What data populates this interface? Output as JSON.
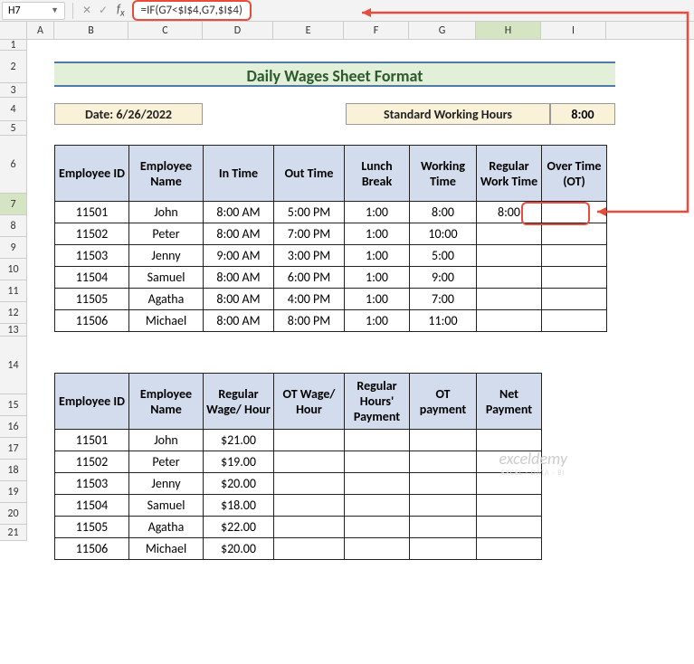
{
  "nameBox": "H7",
  "formula": "=IF(G7<$I$4,G7,$I$4)",
  "columns": [
    "A",
    "B",
    "C",
    "D",
    "E",
    "F",
    "G",
    "H",
    "I"
  ],
  "rows": [
    "1",
    "2",
    "3",
    "4",
    "5",
    "6",
    "7",
    "8",
    "9",
    "10",
    "11",
    "12",
    "13",
    "14",
    "15",
    "16",
    "17",
    "18",
    "19",
    "20",
    "21"
  ],
  "title": "Daily Wages Sheet Format",
  "dateLabel": "Date: 6/26/2022",
  "stdLabel": "Standard Working Hours",
  "stdValue": "8:00",
  "table1": {
    "headers": [
      "Employee ID",
      "Employee Name",
      "In Time",
      "Out Time",
      "Lunch Break",
      "Working Time",
      "Regular Work Time",
      "Over Time (OT)"
    ],
    "rows": [
      [
        "11501",
        "John",
        "8:00 AM",
        "5:00 PM",
        "1:00",
        "8:00",
        "8:00",
        ""
      ],
      [
        "11502",
        "Peter",
        "8:00 AM",
        "7:00 PM",
        "1:00",
        "10:00",
        "",
        ""
      ],
      [
        "11503",
        "Jenny",
        "9:00 AM",
        "3:00 PM",
        "1:00",
        "5:00",
        "",
        ""
      ],
      [
        "11504",
        "Samuel",
        "8:00 AM",
        "6:00 PM",
        "1:00",
        "9:00",
        "",
        ""
      ],
      [
        "11505",
        "Agatha",
        "8:00 AM",
        "4:00 PM",
        "1:00",
        "7:00",
        "",
        ""
      ],
      [
        "11506",
        "Michael",
        "8:00 AM",
        "8:00 PM",
        "1:00",
        "11:00",
        "",
        ""
      ]
    ]
  },
  "table2": {
    "headers": [
      "Employee ID",
      "Employee Name",
      "Regular Wage/ Hour",
      "OT Wage/ Hour",
      "Regular Hours' Payment",
      "OT payment",
      "Net Payment"
    ],
    "rows": [
      [
        "11501",
        "John",
        "$21.00",
        "",
        "",
        "",
        ""
      ],
      [
        "11502",
        "Peter",
        "$19.00",
        "",
        "",
        "",
        ""
      ],
      [
        "11503",
        "Jenny",
        "$20.00",
        "",
        "",
        "",
        ""
      ],
      [
        "11504",
        "Samuel",
        "$18.00",
        "",
        "",
        "",
        ""
      ],
      [
        "11505",
        "Agatha",
        "$22.00",
        "",
        "",
        "",
        ""
      ],
      [
        "11506",
        "Michael",
        "$20.00",
        "",
        "",
        "",
        ""
      ]
    ]
  },
  "watermark": "exceldemy",
  "watermarkSub": "EXCEL · DATA · BI",
  "selectedCol": "H",
  "selectedRow": "7"
}
